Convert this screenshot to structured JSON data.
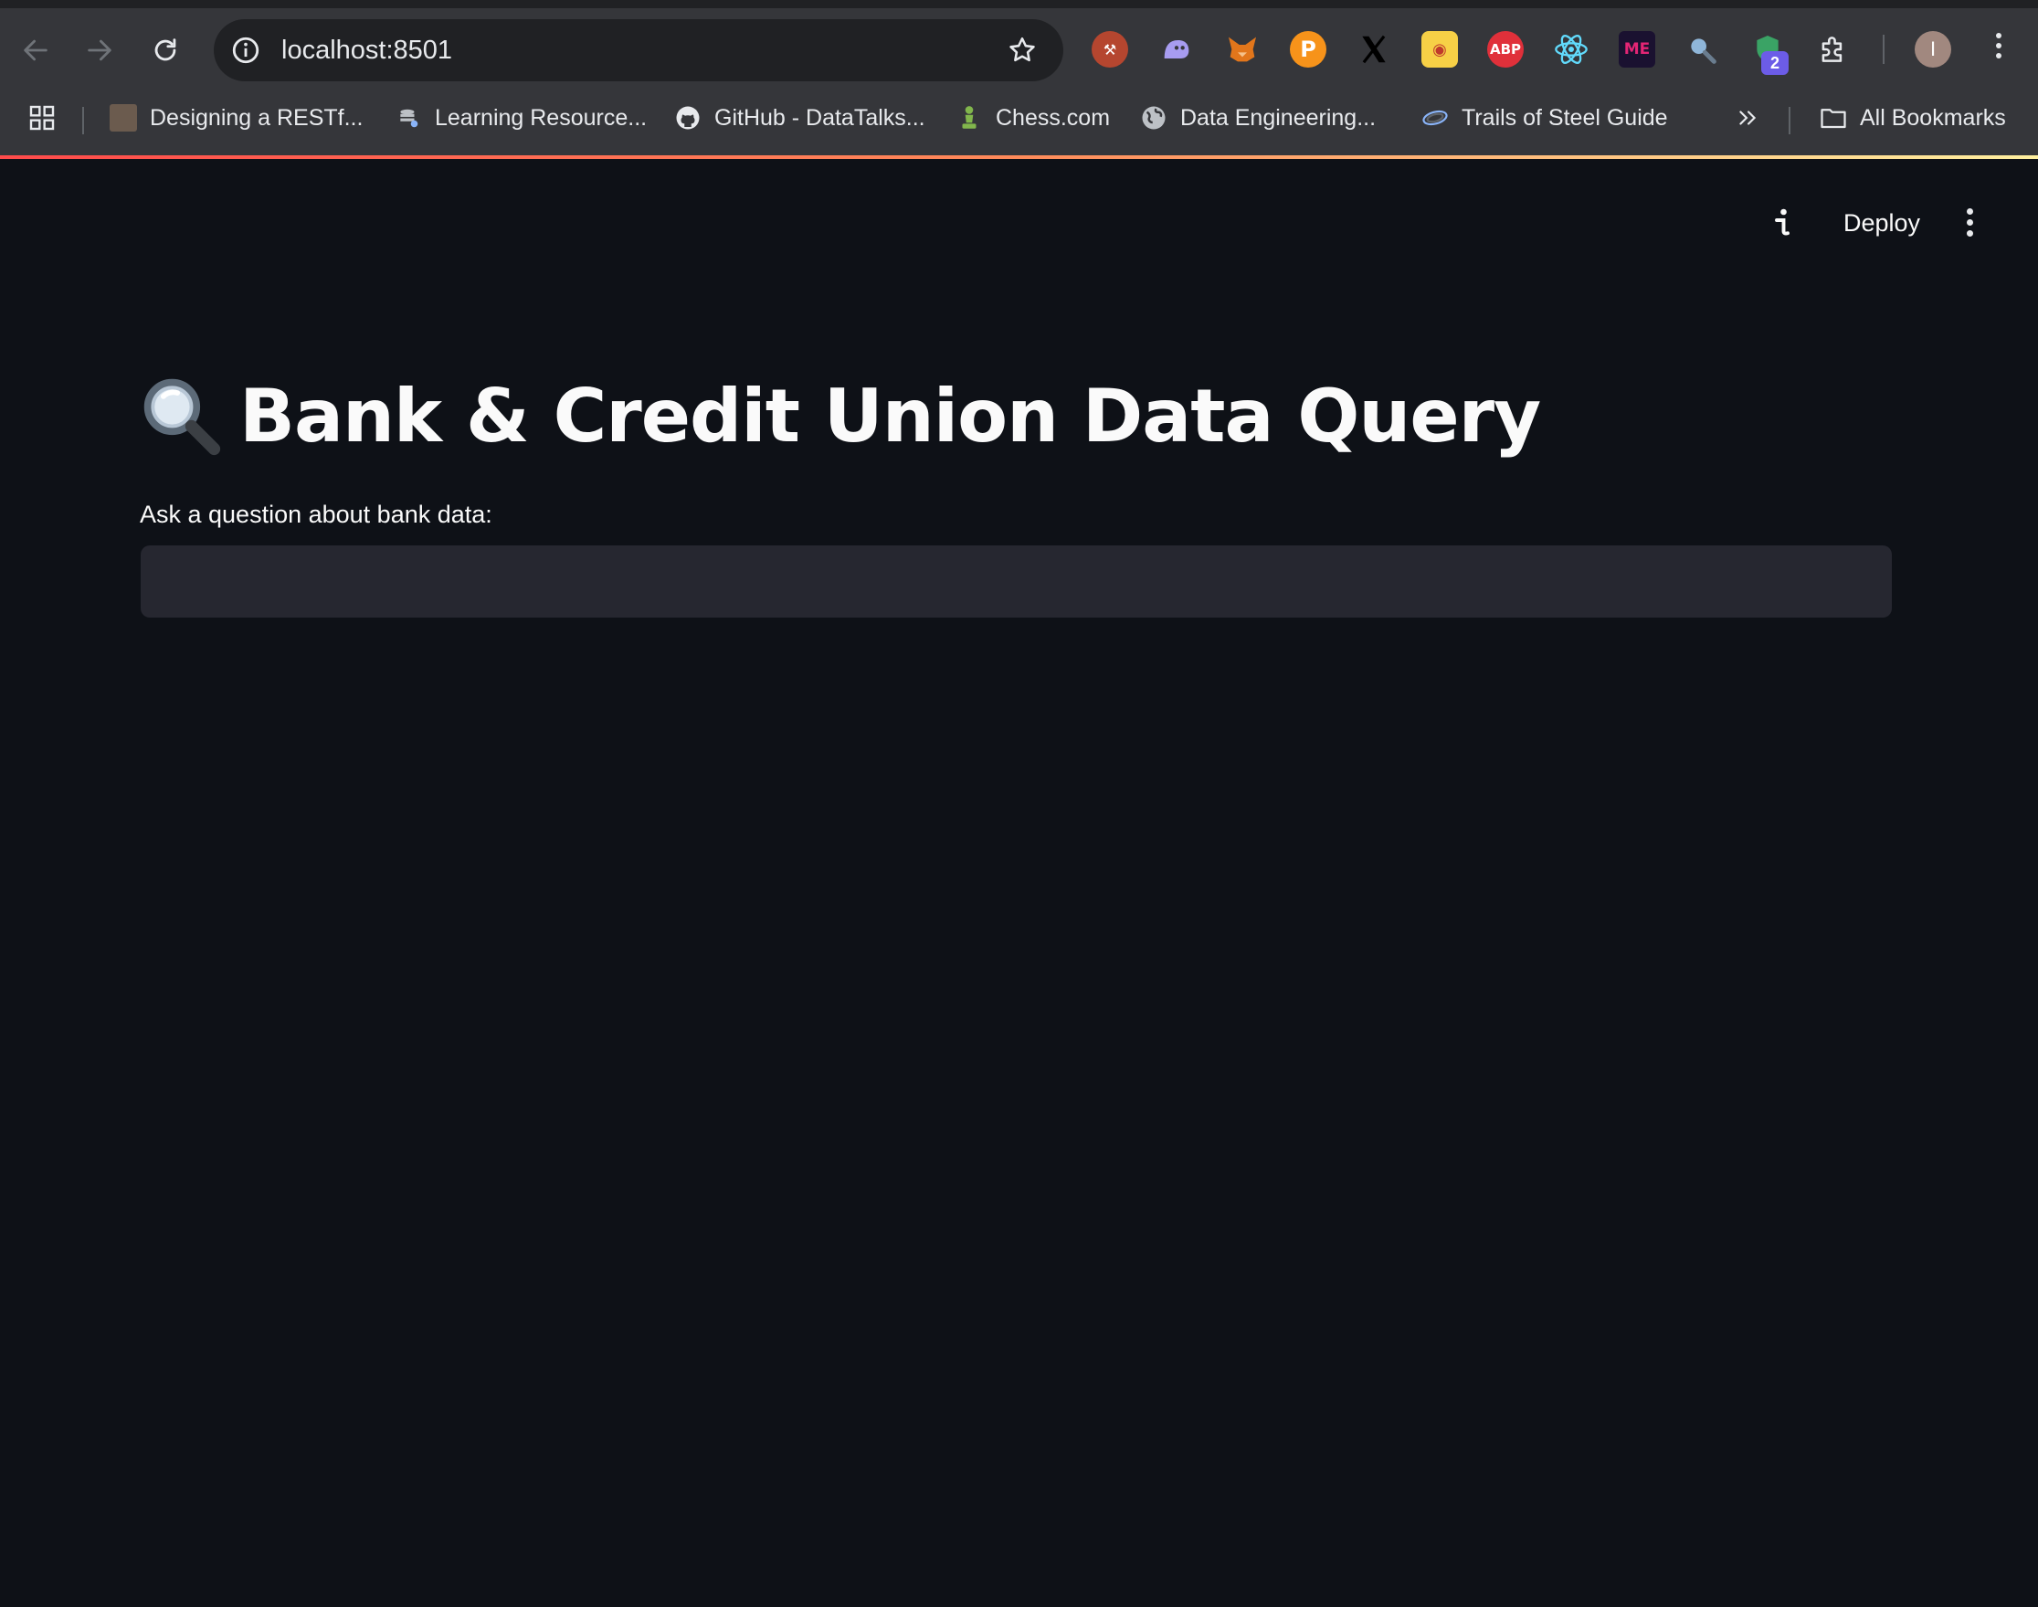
{
  "browser": {
    "url": "localhost:8501",
    "extension_badge_count": "2",
    "profile_initial": "I",
    "extensions": [
      "pickaxe-icon",
      "ghost-icon",
      "metamask-fox-icon",
      "p-coin-icon",
      "x-logo-icon",
      "honey-icon",
      "adblock-plus-icon",
      "react-devtools-icon",
      "magic-eden-icon",
      "magnifier-ext-icon",
      "shield-ext-icon",
      "puzzle-piece-icon"
    ],
    "abp_label": "ABP",
    "bookmarks": [
      {
        "label": "Designing a RESTf...",
        "icon": "avatar-thumb-icon"
      },
      {
        "label": "Learning Resource...",
        "icon": "database-icon"
      },
      {
        "label": "GitHub - DataTalks...",
        "icon": "github-icon"
      },
      {
        "label": "Chess.com",
        "icon": "chess-pawn-icon"
      },
      {
        "label": "Data Engineering...",
        "icon": "globe-icon"
      },
      {
        "label": "Trails of Steel Guide",
        "icon": "swirl-logo-icon"
      }
    ],
    "all_bookmarks": "All Bookmarks"
  },
  "app": {
    "header": {
      "deploy_label": "Deploy"
    },
    "title_icon": "magnifying-glass",
    "title": "Bank & Credit Union Data Query",
    "input": {
      "label": "Ask a question about bank data:",
      "value": "",
      "placeholder": ""
    }
  },
  "colors": {
    "app_background": "#0e1117",
    "input_background": "#262730",
    "chrome_background": "#35363a",
    "omnibox_background": "#202124",
    "text": "#fafafa"
  }
}
